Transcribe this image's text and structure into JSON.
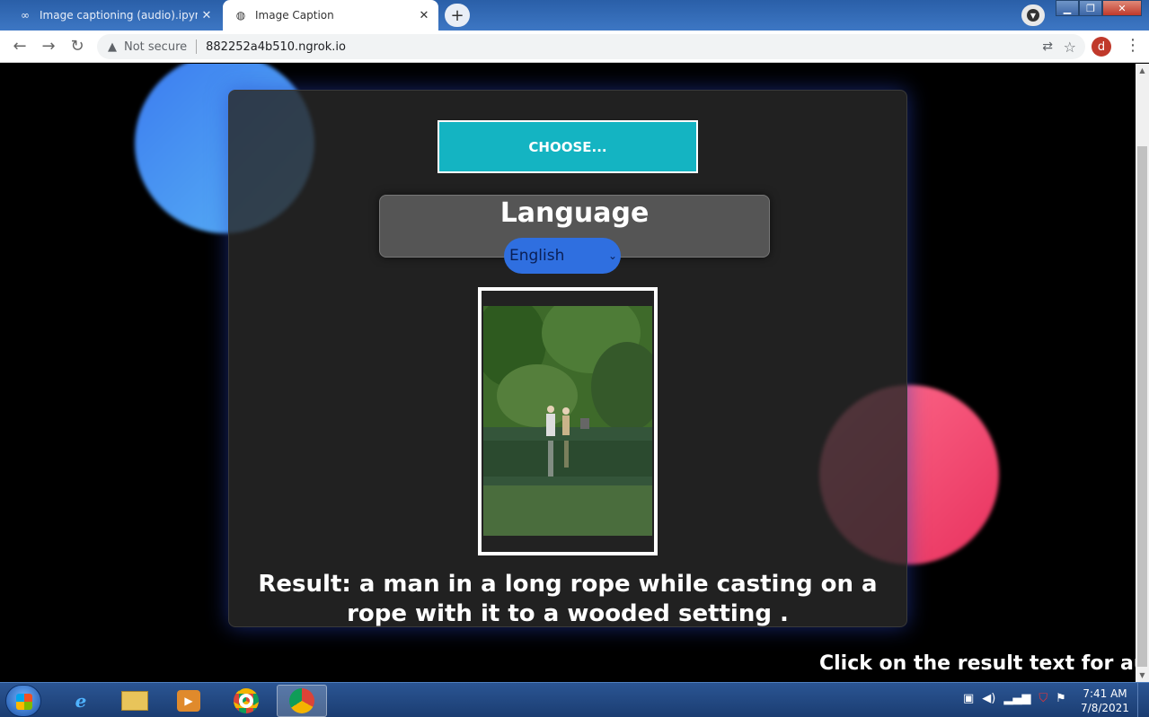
{
  "browser": {
    "tabs": [
      {
        "title": "Image captioning (audio).ipynb -",
        "icon": "colab-icon",
        "active": false
      },
      {
        "title": "Image Caption",
        "icon": "globe-icon",
        "active": true
      }
    ],
    "address": {
      "security_label": "Not secure",
      "url": "882252a4b510.ngrok.io"
    },
    "profile_initial": "d"
  },
  "page": {
    "choose_label": "CHOOSE...",
    "language_title": "Language",
    "language_selected": "English",
    "result_text": "Result: a man in a long rope while casting on a rope with it to a wooded setting .",
    "audio_hint": "Click on the result text for audio",
    "colors": {
      "choose_button": "#14b4c2",
      "select": "#2f6fe0",
      "blob_blue": "#4a9cf3",
      "blob_pink": "#f2466e"
    }
  },
  "taskbar": {
    "time": "7:41 AM",
    "date": "7/8/2021",
    "apps": [
      "start-icon",
      "internet-explorer-icon",
      "file-explorer-icon",
      "media-player-icon",
      "chrome-icon",
      "chrome-profile-icon"
    ]
  }
}
